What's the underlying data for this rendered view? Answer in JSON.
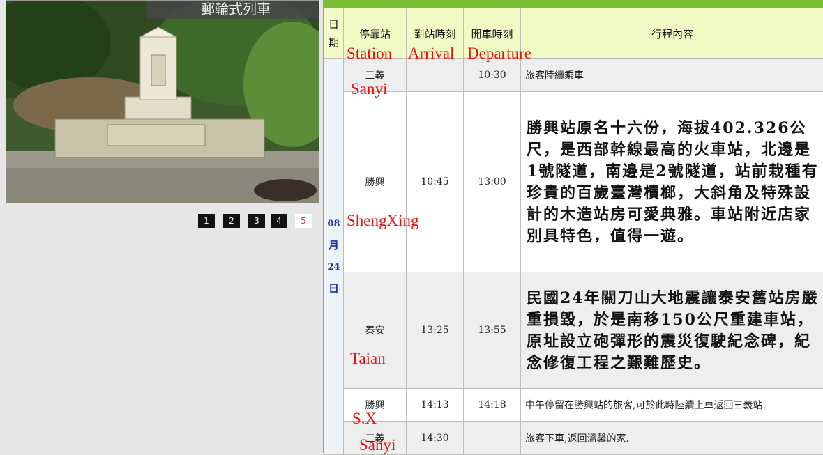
{
  "photo": {
    "caption": "郵輪式列車"
  },
  "pager": {
    "pages": [
      "1",
      "2",
      "3",
      "4",
      "5"
    ],
    "active": "5"
  },
  "table": {
    "headers": {
      "date": "日\n期",
      "station": "停靠站",
      "arrival": "到站時刻",
      "departure": "開車時刻",
      "itinerary": "行程內容"
    },
    "date": {
      "month_num": "08",
      "month": "月",
      "day_num": "24",
      "day": "日"
    },
    "rows": [
      {
        "station": "三義",
        "arrival": "",
        "departure": "10:30",
        "note": "旅客陸續乘車"
      },
      {
        "station": "勝興",
        "arrival": "10:45",
        "departure": "13:00",
        "note": "勝興站原名十六份，海拔402.326公尺，是西部幹線最高的火車站，北邊是1號隧道，南邊是2號隧道，站前栽種有珍貴的百歲臺灣櫝榔，大斜角及特殊設計的木造站房可愛典雅。車站附近店家別具特色，值得一遊。"
      },
      {
        "station": "泰安",
        "arrival": "13:25",
        "departure": "13:55",
        "note": "民國24年關刀山大地震讓泰安舊站房嚴重損毀，於是南移150公尺重建車站，原址設立砲彈形的震災復駛紀念碑，紀念修復工程之艱難歷史。"
      },
      {
        "station": "勝興",
        "arrival": "14:13",
        "departure": "14:18",
        "note": "中午停留在勝興站的旅客,可於此時陸續上車返回三義站."
      },
      {
        "station": "三義",
        "arrival": "14:30",
        "departure": "",
        "note": "旅客下車,返回溫馨的家."
      }
    ]
  },
  "annotations": {
    "station": "Station",
    "arrival": "Arrival",
    "departure": "Departure",
    "sanyi1": "Sanyi",
    "shengxing": "ShengXing",
    "taian": "Taian",
    "sx": "S.X",
    "sanyi2": "Sanyi"
  },
  "colors": {
    "accent_bar": "#7cbf36",
    "header_bg": "#f2fbc6",
    "annotation": "#e81010",
    "date_text": "#1a2fa0"
  }
}
